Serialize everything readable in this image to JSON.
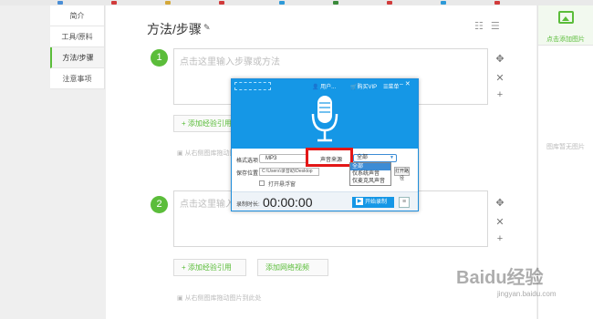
{
  "nav": {
    "items": [
      {
        "label": "简介"
      },
      {
        "label": "工具/原料"
      },
      {
        "label": "方法/步骤"
      },
      {
        "label": "注意事项"
      }
    ]
  },
  "main": {
    "title": "方法/步骤",
    "steps": [
      {
        "number": "1",
        "placeholder": "点击这里输入步骤或方法",
        "add_ref_label": "添加经验引用"
      },
      {
        "number": "2",
        "placeholder": "点击这里输入步骤或方法",
        "add_ref_label": "添加经验引用",
        "add_video_label": "添加网络视频"
      }
    ],
    "drag_hint": "从右侧图库拖动图片到此处"
  },
  "right_panel": {
    "add_image_label": "点击添加图片",
    "empty_label": "图库暂无图片"
  },
  "recorder": {
    "user": "用户...",
    "vip": "购买VIP",
    "menu": "菜单",
    "format_label": "格式选项",
    "format_value": "MP3",
    "source_label": "声音来源",
    "source_value": "全部",
    "source_options": [
      "全部",
      "仅系统声音",
      "仅麦克风声音"
    ],
    "save_label": "保存位置",
    "save_path": "C:\\Users\\录音助\\Desktop",
    "open_folder": "打开路径",
    "floating_label": "打开悬浮窗",
    "time_label": "录制时长:",
    "time_value": "00:00:00",
    "start_label": "开始录制"
  },
  "watermark": {
    "text": "Baidu经验",
    "url": "jingyan.baidu.com"
  },
  "colors": {
    "accent": "#5bbd3a",
    "recorder_blue": "#1597e6",
    "highlight_red": "#e31717"
  }
}
